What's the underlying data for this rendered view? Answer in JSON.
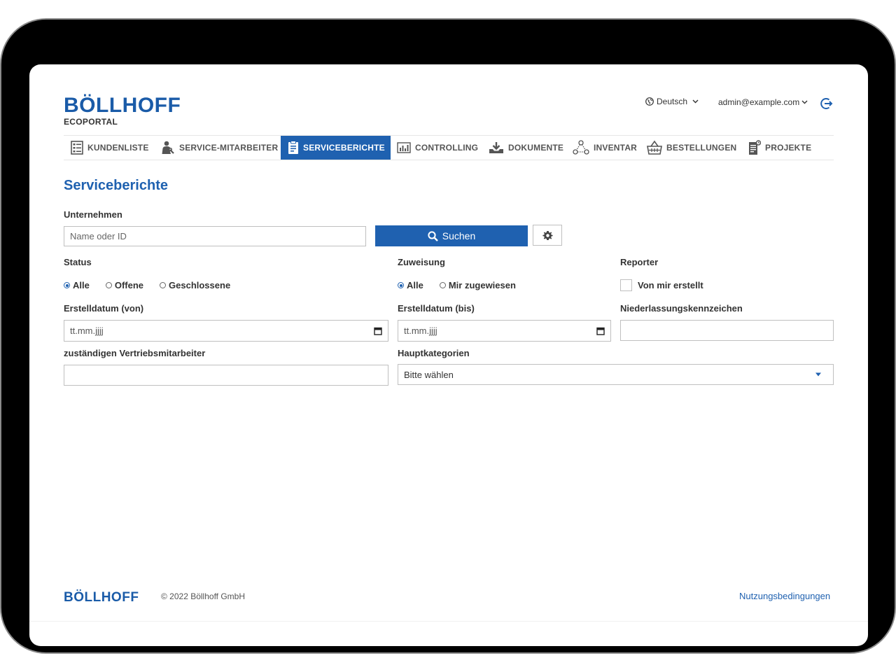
{
  "header": {
    "brand": "BÖLLHOFF",
    "brand_sub": "ECOPORTAL",
    "language": "Deutsch",
    "user_email": "admin@example.com"
  },
  "nav": {
    "items": [
      {
        "label": "KUNDENLISTE",
        "icon": "list-icon"
      },
      {
        "label": "SERVICE-MITARBEITER",
        "icon": "worker-icon"
      },
      {
        "label": "SERVICEBERICHTE",
        "icon": "report-icon",
        "active": true
      },
      {
        "label": "CONTROLLING",
        "icon": "chart-icon"
      },
      {
        "label": "DOKUMENTE",
        "icon": "download-icon"
      },
      {
        "label": "INVENTAR",
        "icon": "network-icon"
      },
      {
        "label": "BESTELLUNGEN",
        "icon": "basket-icon"
      },
      {
        "label": "PROJEKTE",
        "icon": "project-icon"
      }
    ]
  },
  "page": {
    "title": "Serviceberichte"
  },
  "filters": {
    "company_label": "Unternehmen",
    "company_placeholder": "Name oder ID",
    "search_label": "Suchen",
    "status_label": "Status",
    "status_options": [
      "Alle",
      "Offene",
      "Geschlossene"
    ],
    "assignment_label": "Zuweisung",
    "assignment_options": [
      "Alle",
      "Mir zugewiesen"
    ],
    "reporter_label": "Reporter",
    "reporter_option": "Von mir erstellt",
    "date_from_label": "Erstelldatum (von)",
    "date_from_value": "tt.mm.jjjj",
    "date_to_label": "Erstelldatum (bis)",
    "date_to_value": "tt.mm.jjjj",
    "branch_label": "Niederlassungskennzeichen",
    "sales_label": "zuständigen Vertriebsmitarbeiter",
    "category_label": "Hauptkategorien",
    "category_value": "Bitte wählen"
  },
  "footer": {
    "brand": "BÖLLHOFF",
    "copyright": "© 2022 Böllhoff GmbH",
    "terms": "Nutzungsbedingungen"
  },
  "colors": {
    "accent": "#1f61b0",
    "brand": "#1a5ba8"
  }
}
